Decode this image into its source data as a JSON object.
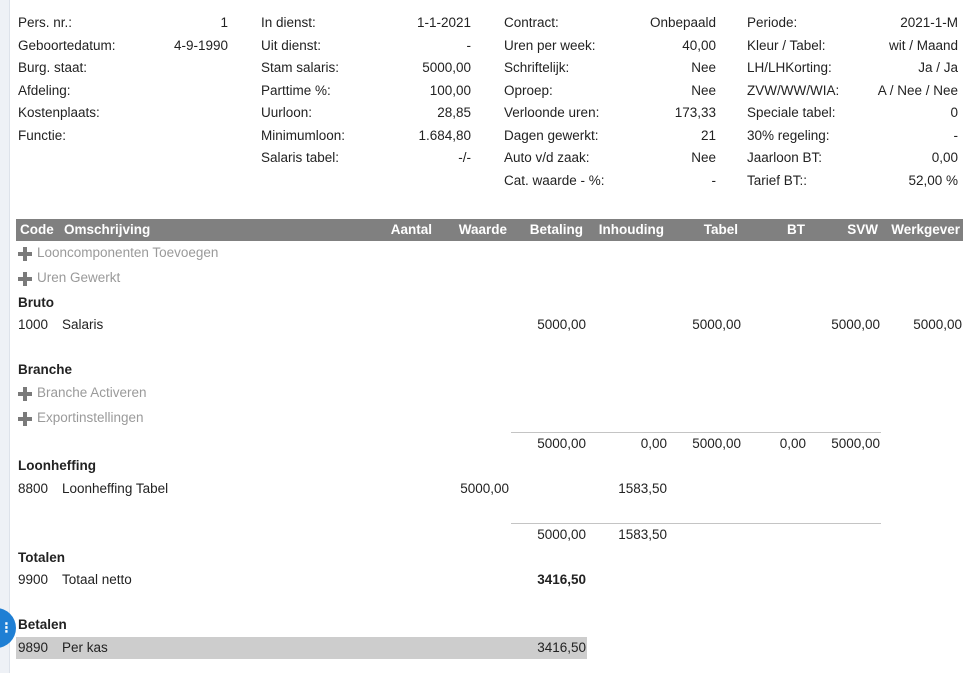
{
  "info_columns": [
    [
      {
        "label": "Pers. nr.:",
        "value": "1"
      },
      {
        "label": "Geboortedatum:",
        "value": "4-9-1990"
      },
      {
        "label": "Burg. staat:",
        "value": ""
      },
      {
        "label": "Afdeling:",
        "value": ""
      },
      {
        "label": "Kostenplaats:",
        "value": ""
      },
      {
        "label": "Functie:",
        "value": ""
      }
    ],
    [
      {
        "label": "In dienst:",
        "value": "1-1-2021"
      },
      {
        "label": "Uit dienst:",
        "value": "-"
      },
      {
        "label": "Stam salaris:",
        "value": "5000,00"
      },
      {
        "label": "Parttime %:",
        "value": "100,00"
      },
      {
        "label": "Uurloon:",
        "value": "28,85"
      },
      {
        "label": "Minimumloon:",
        "value": "1.684,80"
      },
      {
        "label": "Salaris tabel:",
        "value": "-/-"
      }
    ],
    [
      {
        "label": "Contract:",
        "value": "Onbepaald"
      },
      {
        "label": "Uren per week:",
        "value": "40,00"
      },
      {
        "label": "Schriftelijk:",
        "value": "Nee"
      },
      {
        "label": "Oproep:",
        "value": "Nee"
      },
      {
        "label": "Verloonde uren:",
        "value": "173,33"
      },
      {
        "label": "Dagen gewerkt:",
        "value": "21"
      },
      {
        "label": "Auto v/d zaak:",
        "value": "Nee"
      },
      {
        "label": "Cat. waarde - %:",
        "value": "-"
      }
    ],
    [
      {
        "label": "Periode:",
        "value": "2021-1-M"
      },
      {
        "label": "Kleur / Tabel:",
        "value": "wit / Maand"
      },
      {
        "label": "LH/LHKorting:",
        "value": "Ja / Ja"
      },
      {
        "label": "ZVW/WW/WIA:",
        "value": "A / Nee / Nee"
      },
      {
        "label": "Speciale tabel:",
        "value": "0"
      },
      {
        "label": "30% regeling:",
        "value": "-"
      },
      {
        "label": "Jaarloon BT:",
        "value": "0,00"
      },
      {
        "label": "Tarief BT::",
        "value": "52,00 %"
      }
    ]
  ],
  "table": {
    "headers": {
      "code": "Code",
      "omschrijving": "Omschrijving",
      "aantal": "Aantal",
      "waarde": "Waarde",
      "betaling": "Betaling",
      "inhouding": "Inhouding",
      "tabel": "Tabel",
      "bt": "BT",
      "svw": "SVW",
      "werkgever": "Werkgever"
    },
    "add_looncomponenten": "Looncomponenten Toevoegen",
    "add_uren": "Uren Gewerkt",
    "bruto": {
      "title": "Bruto",
      "code": "1000",
      "desc": "Salaris",
      "betaling": "5000,00",
      "tabel": "5000,00",
      "svw": "5000,00",
      "werkgever": "5000,00"
    },
    "branche": {
      "title": "Branche",
      "activeren": "Branche Activeren",
      "export": "Exportinstellingen"
    },
    "subtotal1": {
      "betaling": "5000,00",
      "inhouding": "0,00",
      "tabel": "5000,00",
      "bt": "0,00",
      "svw": "5000,00"
    },
    "loonheffing": {
      "title": "Loonheffing",
      "code": "8800",
      "desc": "Loonheffing Tabel",
      "waarde": "5000,00",
      "inhouding": "1583,50"
    },
    "subtotal2": {
      "betaling": "5000,00",
      "inhouding": "1583,50"
    },
    "totalen": {
      "title": "Totalen",
      "code": "9900",
      "desc": "Totaal netto",
      "betaling": "3416,50"
    },
    "betalen": {
      "title": "Betalen",
      "code": "9890",
      "desc": "Per kas",
      "betaling": "3416,50"
    }
  }
}
